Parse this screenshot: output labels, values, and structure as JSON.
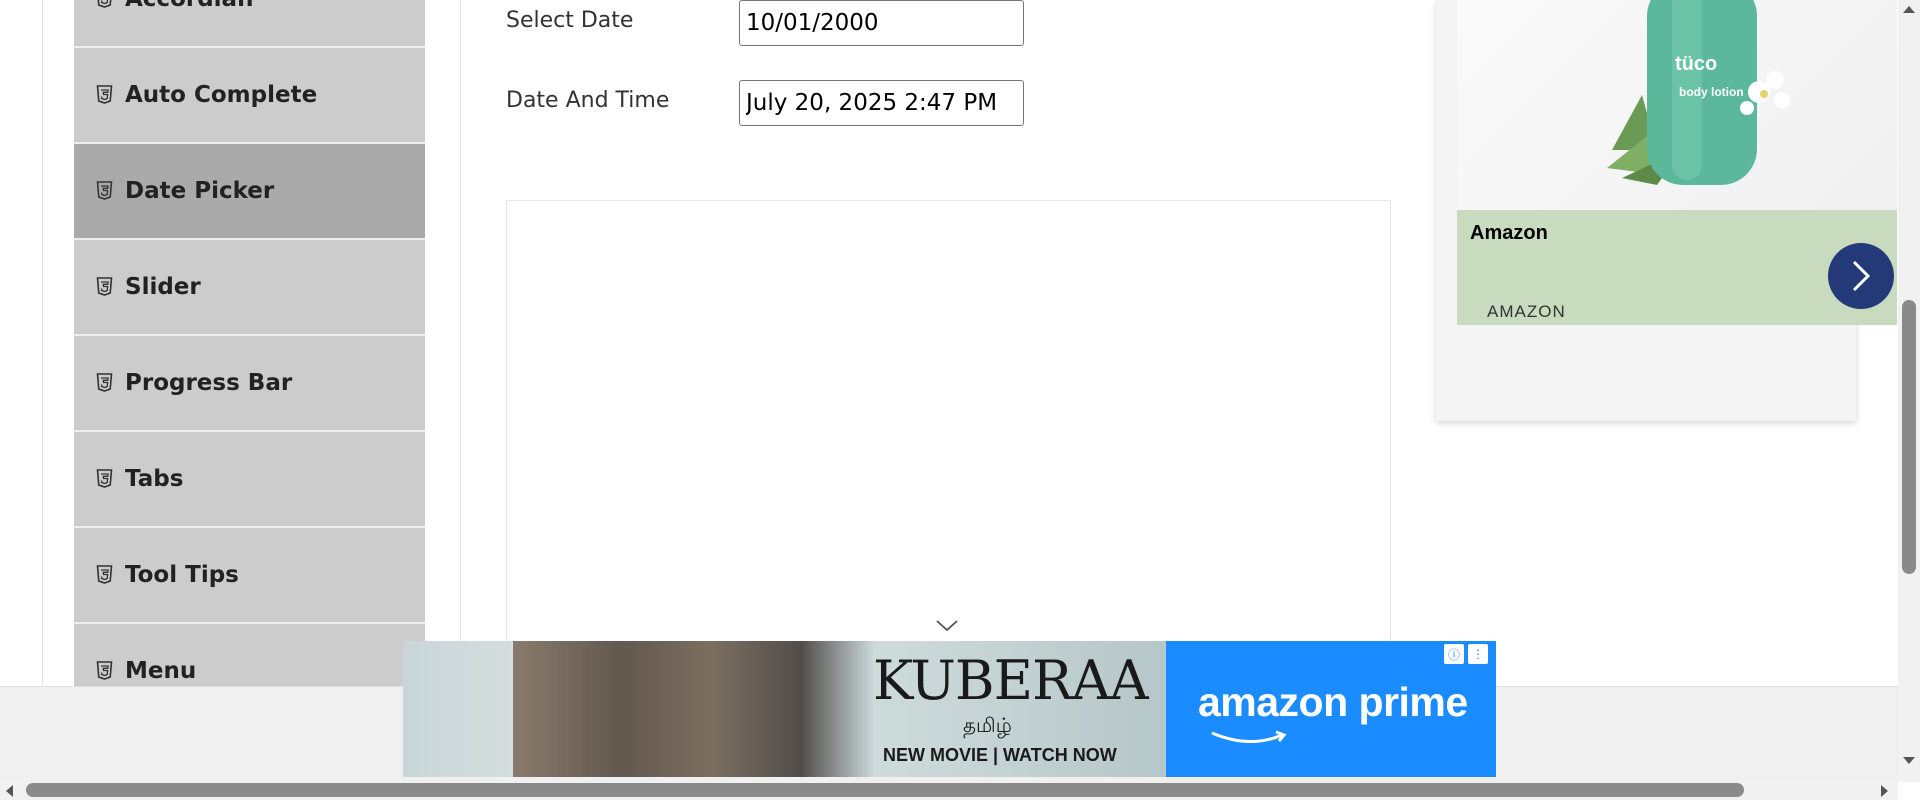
{
  "sidebar": {
    "items": [
      {
        "label": "Accordian",
        "active": false
      },
      {
        "label": "Auto Complete",
        "active": false
      },
      {
        "label": "Date Picker",
        "active": true
      },
      {
        "label": "Slider",
        "active": false
      },
      {
        "label": "Progress Bar",
        "active": false
      },
      {
        "label": "Tabs",
        "active": false
      },
      {
        "label": "Tool Tips",
        "active": false
      },
      {
        "label": "Menu",
        "active": false
      }
    ],
    "item_icon": "html5-icon"
  },
  "form": {
    "select_date_label": "Select Date",
    "select_date_value": "10/01/2000",
    "date_time_label": "Date And Time",
    "date_time_value": "July 20, 2025 2:47 PM"
  },
  "side_ad": {
    "title": "Amazon",
    "brand": "AMAZON",
    "product_text": "tüco",
    "product_sub": "body lotion",
    "arrow_icon": "chevron-right-icon",
    "accent_color": "#243a78",
    "info_bg": "#c8dbbe"
  },
  "bottom_ad": {
    "movie_title": "KUBERAA",
    "language": "தமிழ்",
    "cta": "NEW MOVIE | WATCH NOW",
    "service": "amazon prime",
    "service_color": "#1a8cff",
    "info_icon": "info-icon",
    "menu_icon": "more-vertical-icon"
  }
}
